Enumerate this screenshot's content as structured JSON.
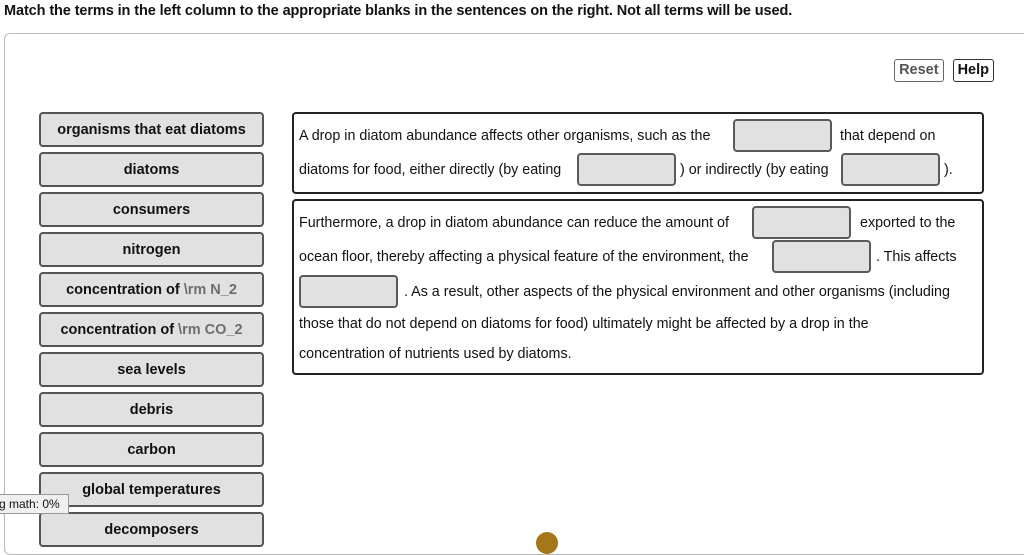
{
  "instructions": "Match the terms in the left column to the appropriate blanks in the sentences on the right. Not all terms will be used.",
  "toolbar": {
    "reset_label": "Reset",
    "help_label": "Help"
  },
  "terms": [
    {
      "label": "organisms that eat diatoms",
      "tex": ""
    },
    {
      "label": "diatoms",
      "tex": ""
    },
    {
      "label": "consumers",
      "tex": ""
    },
    {
      "label": "nitrogen",
      "tex": ""
    },
    {
      "label": "concentration of",
      "tex": "\\rm N_2"
    },
    {
      "label": "concentration of",
      "tex": "\\rm CO_2"
    },
    {
      "label": "sea levels",
      "tex": ""
    },
    {
      "label": "debris",
      "tex": ""
    },
    {
      "label": "carbon",
      "tex": ""
    },
    {
      "label": "global temperatures",
      "tex": ""
    },
    {
      "label": "decomposers",
      "tex": ""
    }
  ],
  "sentence1": {
    "t1": "A drop in diatom abundance affects other organisms, such as the",
    "t2": "that depend on",
    "t3": "diatoms for food, either directly (by eating",
    "t4": ") or indirectly (by eating",
    "t5": ")."
  },
  "sentence2": {
    "t1": "Furthermore, a drop in diatom abundance can reduce the amount of",
    "t2": "exported to the",
    "t3": "ocean floor, thereby affecting a physical feature of the environment, the",
    "t4": ". This affects",
    "t5": ". As a result, other aspects of the physical environment and other organisms (including",
    "t6": "those that do not depend on diatoms for food) ultimately might be affected by a drop in the",
    "t7": "concentration of nutrients used by diatoms."
  },
  "status": {
    "math_loading": "g math: 0%"
  }
}
